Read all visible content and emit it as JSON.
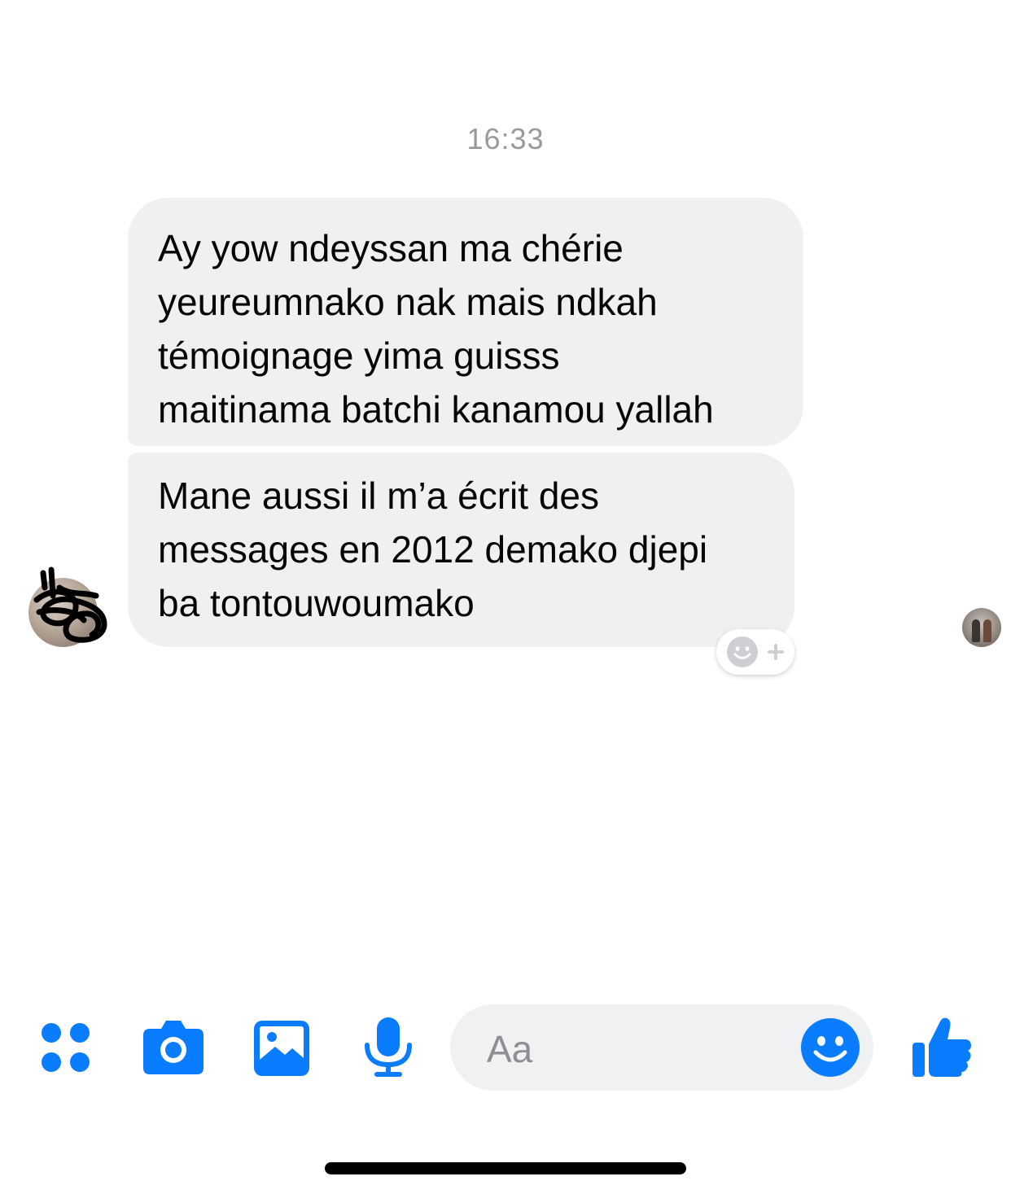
{
  "conversation": {
    "timestamp": "16:33",
    "messages": [
      {
        "sender": "incoming",
        "text": "Ay yow ndeyssan ma chérie\nyeureumnako nak mais ndkah\ntémoignage yima guisss\nmaitinama batchi kanamou yallah"
      },
      {
        "sender": "incoming",
        "text": "Mane aussi il m’a écrit des\nmessages en 2012 demako djepi\nba tontouwoumako"
      }
    ]
  },
  "composer": {
    "placeholder": "Aa"
  },
  "icons": {
    "more": "four-dots-icon",
    "camera": "camera-icon",
    "gallery": "image-icon",
    "voice": "microphone-icon",
    "emoji": "smiley-icon",
    "like": "thumbs-up-icon",
    "add_reaction": "add-reaction-icon"
  },
  "colors": {
    "accent": "#0a7cff",
    "bubble_incoming": "#f0f0f0",
    "timestamp": "#9a9a9e"
  }
}
